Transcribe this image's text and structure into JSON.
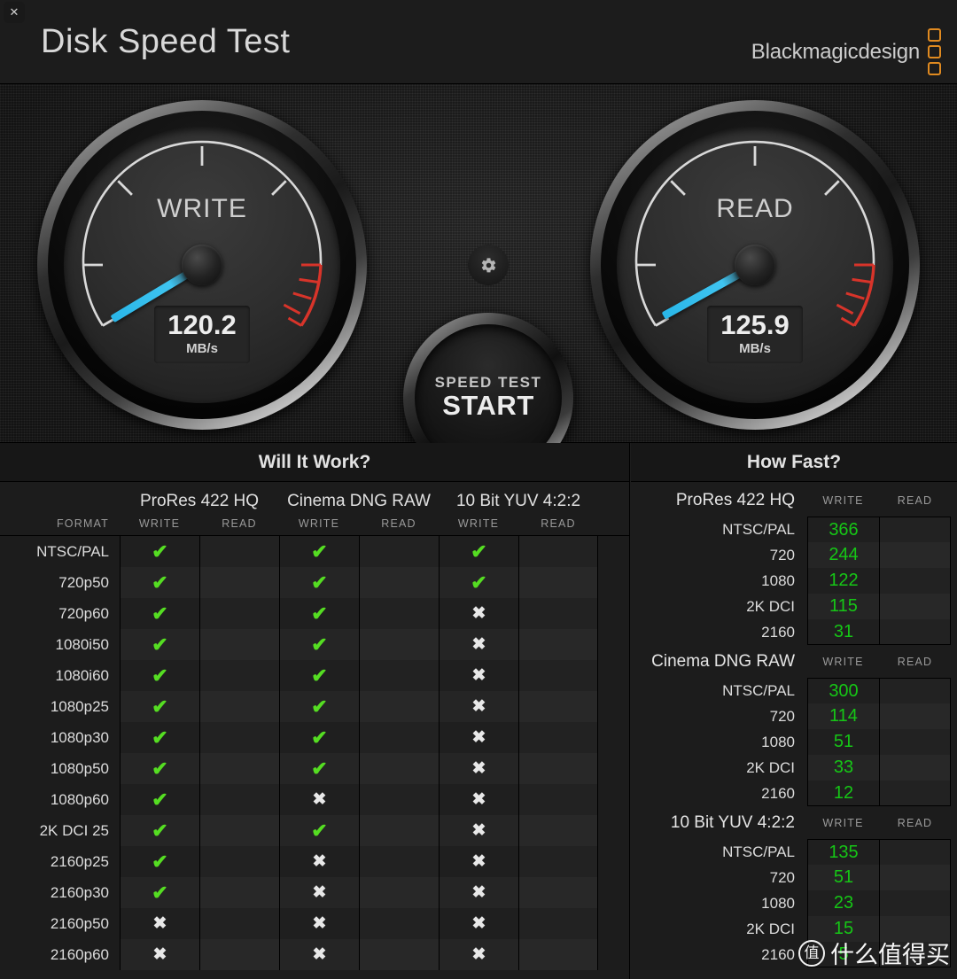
{
  "titlebar": {
    "close_icon": "close-icon",
    "title": "Disk Speed Test",
    "brand": "Blackmagicdesign"
  },
  "gauges": {
    "write": {
      "label": "WRITE",
      "value": "120.2",
      "unit": "MB/s",
      "needle_angle": -31
    },
    "read": {
      "label": "READ",
      "value": "125.9",
      "unit": "MB/s",
      "needle_angle": -29
    }
  },
  "start_button": {
    "line1": "SPEED TEST",
    "line2": "START"
  },
  "settings_icon": "gear-icon",
  "will_it_work": {
    "title": "Will It Work?",
    "format_column_header": "FORMAT",
    "codecs": [
      "ProRes 422 HQ",
      "Cinema DNG RAW",
      "10 Bit YUV 4:2:2"
    ],
    "sub_headers": [
      "WRITE",
      "READ"
    ],
    "check_glyph": "✔",
    "cross_glyph": "✖",
    "rows": [
      {
        "format": "NTSC/PAL",
        "cells": [
          true,
          null,
          true,
          null,
          true,
          null
        ]
      },
      {
        "format": "720p50",
        "cells": [
          true,
          null,
          true,
          null,
          true,
          null
        ]
      },
      {
        "format": "720p60",
        "cells": [
          true,
          null,
          true,
          null,
          false,
          null
        ]
      },
      {
        "format": "1080i50",
        "cells": [
          true,
          null,
          true,
          null,
          false,
          null
        ]
      },
      {
        "format": "1080i60",
        "cells": [
          true,
          null,
          true,
          null,
          false,
          null
        ]
      },
      {
        "format": "1080p25",
        "cells": [
          true,
          null,
          true,
          null,
          false,
          null
        ]
      },
      {
        "format": "1080p30",
        "cells": [
          true,
          null,
          true,
          null,
          false,
          null
        ]
      },
      {
        "format": "1080p50",
        "cells": [
          true,
          null,
          true,
          null,
          false,
          null
        ]
      },
      {
        "format": "1080p60",
        "cells": [
          true,
          null,
          false,
          null,
          false,
          null
        ]
      },
      {
        "format": "2K DCI 25",
        "cells": [
          true,
          null,
          true,
          null,
          false,
          null
        ]
      },
      {
        "format": "2160p25",
        "cells": [
          true,
          null,
          false,
          null,
          false,
          null
        ]
      },
      {
        "format": "2160p30",
        "cells": [
          true,
          null,
          false,
          null,
          false,
          null
        ]
      },
      {
        "format": "2160p50",
        "cells": [
          false,
          null,
          false,
          null,
          false,
          null
        ]
      },
      {
        "format": "2160p60",
        "cells": [
          false,
          null,
          false,
          null,
          false,
          null
        ]
      }
    ]
  },
  "how_fast": {
    "title": "How Fast?",
    "sub_headers": [
      "WRITE",
      "READ"
    ],
    "groups": [
      {
        "name": "ProRes 422 HQ",
        "rows": [
          {
            "resolution": "NTSC/PAL",
            "write": "366",
            "read": ""
          },
          {
            "resolution": "720",
            "write": "244",
            "read": ""
          },
          {
            "resolution": "1080",
            "write": "122",
            "read": ""
          },
          {
            "resolution": "2K DCI",
            "write": "115",
            "read": ""
          },
          {
            "resolution": "2160",
            "write": "31",
            "read": ""
          }
        ]
      },
      {
        "name": "Cinema DNG RAW",
        "rows": [
          {
            "resolution": "NTSC/PAL",
            "write": "300",
            "read": ""
          },
          {
            "resolution": "720",
            "write": "114",
            "read": ""
          },
          {
            "resolution": "1080",
            "write": "51",
            "read": ""
          },
          {
            "resolution": "2K DCI",
            "write": "33",
            "read": ""
          },
          {
            "resolution": "2160",
            "write": "12",
            "read": ""
          }
        ]
      },
      {
        "name": "10 Bit YUV 4:2:2",
        "rows": [
          {
            "resolution": "NTSC/PAL",
            "write": "135",
            "read": ""
          },
          {
            "resolution": "720",
            "write": "51",
            "read": ""
          },
          {
            "resolution": "1080",
            "write": "23",
            "read": ""
          },
          {
            "resolution": "2K DCI",
            "write": "15",
            "read": ""
          },
          {
            "resolution": "2160",
            "write": "5",
            "read": ""
          }
        ]
      }
    ]
  },
  "watermark": {
    "badge": "值",
    "text": "什么值得买"
  },
  "colors": {
    "accent_green": "#16C616",
    "check_green": "#55DD22",
    "brand_orange": "#E08A20",
    "needle_blue": "#3FC4F0",
    "redzone": "#D8342A"
  }
}
